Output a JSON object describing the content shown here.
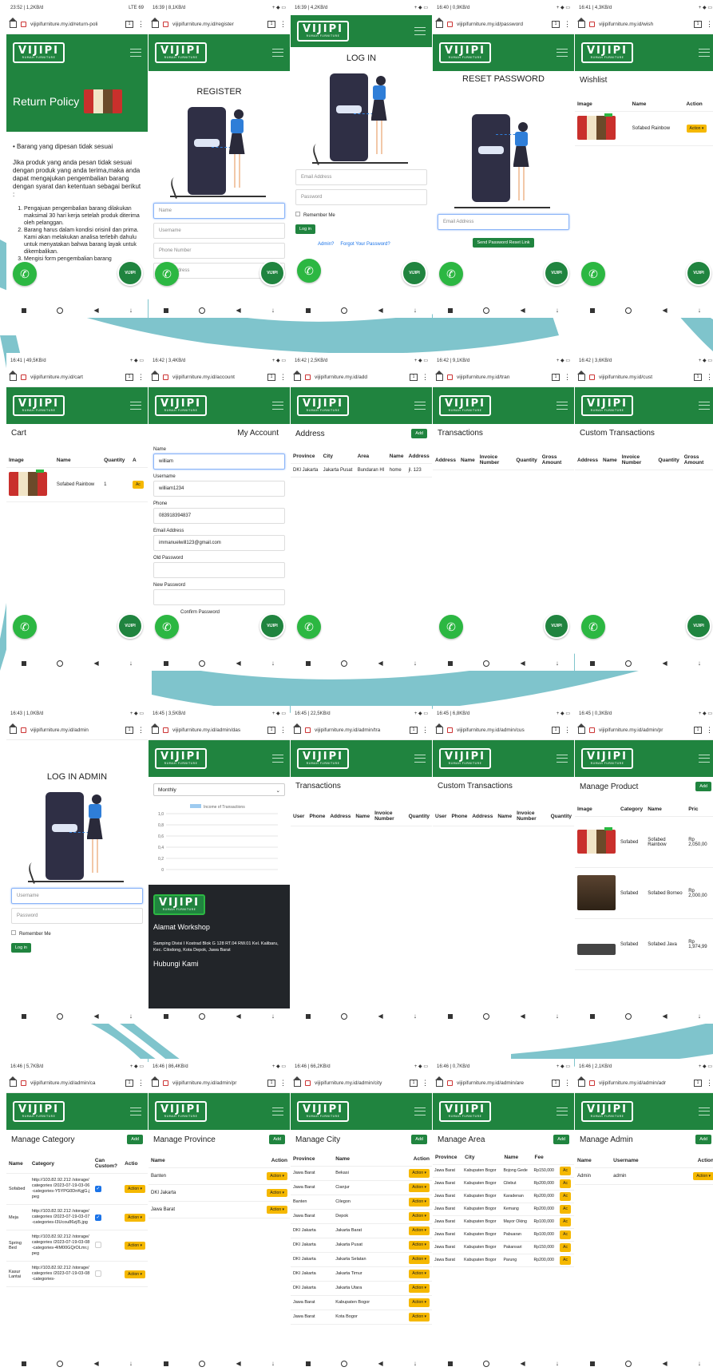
{
  "site": {
    "logo": "VIJIPI",
    "tagline": "RUMAH FURNITURE",
    "whatsapp_icon": "whatsapp-icon",
    "fab_label": "VIJIPI",
    "menu_icon": "hamburger-icon"
  },
  "screens": {
    "s1": {
      "status_left": "23:52 | 1,2KB/d",
      "status_right": "LTE 69",
      "url": "vijipifurniture.my.id/return-poli",
      "hero_title": "Return Policy",
      "bullet": "Barang yang dipesan tidak sesuai",
      "para": "Jika produk yang anda pesan tidak sesuai dengan produk yang anda terima,maka anda dapat mengajukan pengembalian barang dengan syarat dan ketentuan sebagai berikut :",
      "items": [
        "Pengajuan pengembalian barang dilakukan maksimal 30 hari kerja setelah produk diterima oleh pelanggan.",
        "Barang harus dalam kondisi orisinil dan prima. Kami akan melakukan analisa terlebih dahulu untuk menyatakan bahwa barang layak untuk dikembalikan.",
        "Mengisi form pengembalian barang"
      ]
    },
    "s2": {
      "status_left": "16:39 | 8,1KB/d",
      "url": "vijipifurniture.my.id/register",
      "title": "REGISTER",
      "fields": [
        "Name",
        "Username",
        "Phone Number",
        "Email Address"
      ]
    },
    "s3": {
      "status_left": "16:39 | 4,2KB/d",
      "title": "LOG IN",
      "fields": [
        "Email Address",
        "Password"
      ],
      "remember": "Remember Me",
      "login_btn": "Log in",
      "admin_link": "Admin?",
      "forgot_link": "Forgot Your Password?"
    },
    "s4": {
      "status_left": "16:40 | 0,9KB/d",
      "url": "vijipifurniture.my.id/password",
      "title": "RESET PASSWORD",
      "field": "Email Address",
      "btn": "Send Password Reset Link"
    },
    "s5": {
      "status_left": "16:41 | 4,3KB/d",
      "url": "vijipifurniture.my.id/wish",
      "title": "Wishlist",
      "headers": [
        "Image",
        "Name",
        "Action"
      ],
      "row": {
        "name": "Sofabed Rainbow",
        "action": "Action ▾"
      }
    },
    "s6": {
      "status_left": "16:41 | 49,5KB/d",
      "url": "vijipifurniture.my.id/cart",
      "title": "Cart",
      "headers": [
        "Image",
        "Name",
        "Quantity",
        "A"
      ],
      "row": {
        "name": "Sofabed Rainbow",
        "qty": "1",
        "action": "Ac"
      }
    },
    "s7": {
      "status_left": "16:42 | 3,4KB/d",
      "url": "vijipifurniture.my.id/account",
      "title": "My Account",
      "fields": [
        {
          "label": "Name",
          "value": "william"
        },
        {
          "label": "Username",
          "value": "william1234"
        },
        {
          "label": "Phone",
          "value": "083918394837"
        },
        {
          "label": "Email Address",
          "value": "immanuelwill123@gmail.com"
        },
        {
          "label": "Old Password",
          "value": ""
        },
        {
          "label": "New Password",
          "value": ""
        },
        {
          "label": "Confirm Password",
          "value": ""
        }
      ]
    },
    "s8": {
      "status_left": "16:42 | 2,5KB/d",
      "url": "vijipifurniture.my.id/add",
      "title": "Address",
      "add_btn": "Add",
      "headers": [
        "Province",
        "City",
        "Area",
        "Name",
        "Address"
      ],
      "row": [
        "DKI Jakarta",
        "Jakarta Pusat",
        "Bundaran HI",
        "home",
        "jl. 123"
      ]
    },
    "s9": {
      "status_left": "16:42 | 9,1KB/d",
      "url": "vijipifurniture.my.id/tran",
      "title": "Transactions",
      "headers": [
        "Address",
        "Name",
        "Invoice Number",
        "Quantity",
        "Gross Amount"
      ]
    },
    "s10": {
      "status_left": "16:42 | 3,6KB/d",
      "url": "vijipifurniture.my.id/cust",
      "title": "Custom Transactions",
      "headers": [
        "Address",
        "Name",
        "Invoice Number",
        "Quantity",
        "Gross Amount"
      ]
    },
    "s11": {
      "status_left": "16:43 | 1,0KB/d",
      "url": "vijipifurniture.my.id/admin",
      "title": "LOG IN ADMIN",
      "fields": [
        "Username",
        "Password"
      ],
      "remember": "Remember Me",
      "login_btn": "Log in"
    },
    "s12": {
      "status_left": "16:45 | 3,5KB/d",
      "url": "vijipifurniture.my.id/admin/das",
      "select": "Monthly",
      "legend": "Income of Transactions",
      "footer_title": "Alamat Workshop",
      "address": "Samping Divisi I Kostrad Blok G 128 RT.04 RW.01 Kel. Kalibaru, Kec. Cilodong, Kota Depok, Jawa Barat",
      "contact_title": "Hubungi Kami"
    },
    "s13": {
      "status_left": "16:45 | 22,5KB/d",
      "url": "vijipifurniture.my.id/admin/tra",
      "title": "Transactions",
      "headers": [
        "User",
        "Phone",
        "Address",
        "Name",
        "Invoice Number",
        "Quantity"
      ]
    },
    "s14": {
      "status_left": "16:45 | 6,8KB/d",
      "url": "vijipifurniture.my.id/admin/cus",
      "title": "Custom Transactions",
      "headers": [
        "User",
        "Phone",
        "Address",
        "Name",
        "Invoice Number",
        "Quantity"
      ]
    },
    "s15": {
      "status_left": "16:45 | 0,3KB/d",
      "url": "vijipifurniture.my.id/admin/pr",
      "title": "Manage Product",
      "add_btn": "Add",
      "headers": [
        "Image",
        "Category",
        "Name",
        "Pric"
      ],
      "rows": [
        {
          "cat": "Sofabed",
          "name": "Sofabed Rainbow",
          "price": "Rp 2,050,00"
        },
        {
          "cat": "Sofabed",
          "name": "Sofabed Borneo",
          "price": "Rp 2,000,00"
        },
        {
          "cat": "Sofabed",
          "name": "Sofabed Java",
          "price": "Rp 1,974,99"
        }
      ]
    },
    "s16": {
      "status_left": "16:46 | 5,7KB/d",
      "url": "vijipifurniture.my.id/admin/ca",
      "title": "Manage Category",
      "add_btn": "Add",
      "headers": [
        "Name",
        "Category",
        "Can Custom?",
        "Actio"
      ],
      "rows": [
        {
          "name": "Sofabed",
          "cat": "http://103.82.92.212 /storage/categories /2023-07-19-03-06-categories-Y5YPG0DnKgjG.jpeg",
          "custom": true
        },
        {
          "name": "Meja",
          "cat": "http://103.82.92.212 /storage/categories /2023-07-19-03-07-categories-I3Ucou86zjI5.jpg",
          "custom": true
        },
        {
          "name": "Spring Bed",
          "cat": "http://103.82.92.212 /storage/categories /2023-07-19-03-08-categories-4IM00GQrOLmr.jpeg",
          "custom": false
        },
        {
          "name": "Kasur Lantai",
          "cat": "http://103.82.92.212 /storage/categories /2023-07-19-03-08-categories-",
          "custom": false
        }
      ],
      "action": "Action ▾"
    },
    "s17": {
      "status_left": "16:46 | 86,4KB/d",
      "url": "vijipifurniture.my.id/admin/pr",
      "title": "Manage Province",
      "add_btn": "Add",
      "headers": [
        "Name",
        "Action"
      ],
      "rows": [
        "Banten",
        "DKI Jakarta",
        "Jawa Barat"
      ],
      "action": "Action ▾"
    },
    "s18": {
      "status_left": "16:46 | 66,2KB/d",
      "url": "vijipifurniture.my.id/admin/city",
      "title": "Manage City",
      "add_btn": "Add",
      "headers": [
        "Province",
        "Name",
        "Action"
      ],
      "rows": [
        [
          "Jawa Barat",
          "Bekasi"
        ],
        [
          "Jawa Barat",
          "Cianjur"
        ],
        [
          "Banten",
          "Cilegon"
        ],
        [
          "Jawa Barat",
          "Depok"
        ],
        [
          "DKI Jakarta",
          "Jakarta Barat"
        ],
        [
          "DKI Jakarta",
          "Jakarta Pusat"
        ],
        [
          "DKI Jakarta",
          "Jakarta Selatan"
        ],
        [
          "DKI Jakarta",
          "Jakarta Timur"
        ],
        [
          "DKI Jakarta",
          "Jakarta Utara"
        ],
        [
          "Jawa Barat",
          "Kabupaten Bogor"
        ],
        [
          "Jawa Barat",
          "Kota Bogor"
        ]
      ],
      "action": "Action ▾"
    },
    "s19": {
      "status_left": "16:46 | 0,7KB/d",
      "url": "vijipifurniture.my.id/admin/are",
      "title": "Manage Area",
      "add_btn": "Add",
      "headers": [
        "Province",
        "City",
        "Name",
        "Fee"
      ],
      "rows": [
        [
          "Jawa Barat",
          "Kabupaten Bogor",
          "Bojong Gede",
          "Rp150,000"
        ],
        [
          "Jawa Barat",
          "Kabupaten Bogor",
          "Cilebut",
          "Rp200,000"
        ],
        [
          "Jawa Barat",
          "Kabupaten Bogor",
          "Karadenan",
          "Rp200,000"
        ],
        [
          "Jawa Barat",
          "Kabupaten Bogor",
          "Kemang",
          "Rp200,000"
        ],
        [
          "Jawa Barat",
          "Kabupaten Bogor",
          "Mayor Oking",
          "Rp100,000"
        ],
        [
          "Jawa Barat",
          "Kabupaten Bogor",
          "Pabuaran",
          "Rp100,000"
        ],
        [
          "Jawa Barat",
          "Kabupaten Bogor",
          "Pakansari",
          "Rp150,000"
        ],
        [
          "Jawa Barat",
          "Kabupaten Bogor",
          "Parung",
          "Rp200,000"
        ]
      ],
      "action": "Ac"
    },
    "s20": {
      "status_left": "16:46 | 2,1KB/d",
      "url": "vijipifurniture.my.id/admin/adr",
      "title": "Manage Admin",
      "add_btn": "Add",
      "headers": [
        "Name",
        "Username",
        "Action"
      ],
      "row": [
        "Admin",
        "admin",
        "Action ▾"
      ]
    }
  },
  "chart_data": {
    "type": "line",
    "title": "",
    "series": [
      {
        "name": "Income of Transactions",
        "values": []
      }
    ],
    "ylabel": "",
    "xlabel": "",
    "yticks": [
      "1,0",
      "0,8",
      "0,6",
      "0,4",
      "0,2",
      "0"
    ],
    "ylim": [
      0,
      1
    ]
  },
  "colors": {
    "brand_green": "#20843f",
    "whatsapp_green": "#2cb742",
    "action_yellow": "#f5b800",
    "swoosh_teal": "#7fc4cc"
  }
}
